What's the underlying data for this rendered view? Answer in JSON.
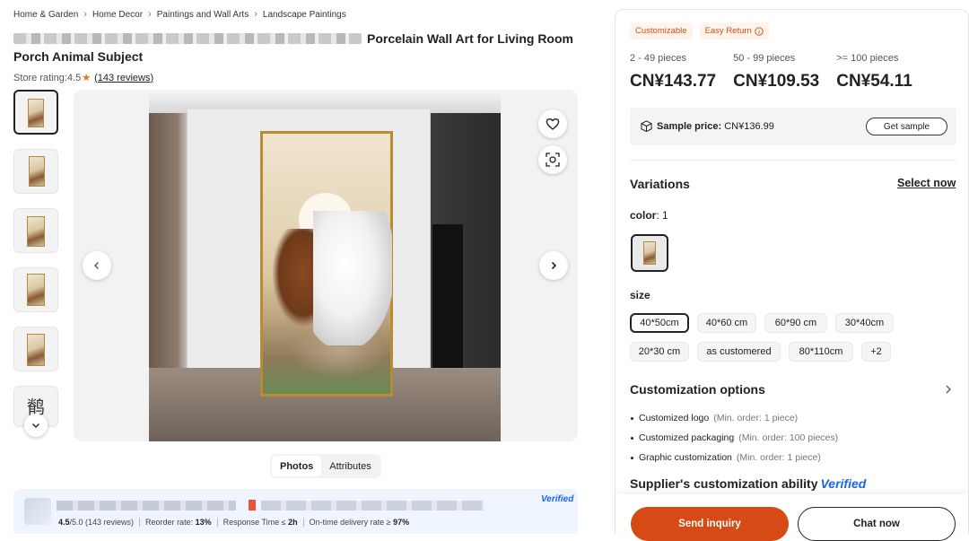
{
  "breadcrumb": [
    "Home & Garden",
    "Home Decor",
    "Paintings and Wall Arts",
    "Landscape Paintings"
  ],
  "product": {
    "title_visible": "Porcelain Wall Art for Living Room Porch Animal Subject",
    "title_line1_tail": "Porcelain Wall Art for Living Room",
    "title_line2": "Porch Animal Subject",
    "store_rating_label": "Store rating:",
    "store_rating_value": "4.5",
    "reviews_link": "(143 reviews)"
  },
  "gallery": {
    "tabs": [
      {
        "label": "Photos",
        "active": true
      },
      {
        "label": "Attributes",
        "active": false
      }
    ],
    "thumbnail_count": 6,
    "selected_thumbnail": 0
  },
  "supplier": {
    "verified": "Verified",
    "rating": "4.5",
    "rating_suffix": "/5.0 (143 reviews)",
    "reorder_label": "Reorder rate:",
    "reorder_value": "13%",
    "response_label": "Response Time ≤",
    "response_value": "2h",
    "ontime_label": "On-time delivery rate ≥",
    "ontime_value": "97%"
  },
  "badges": [
    "Customizable",
    "Easy Return"
  ],
  "pricing": [
    {
      "range": "2 - 49 pieces",
      "price": "CN¥143.77"
    },
    {
      "range": "50 - 99 pieces",
      "price": "CN¥109.53"
    },
    {
      "range": ">= 100 pieces",
      "price": "CN¥54.11"
    }
  ],
  "sample": {
    "label": "Sample price:",
    "price": "CN¥136.99",
    "button": "Get sample"
  },
  "variations": {
    "title": "Variations",
    "select_now": "Select now",
    "color_label": "color",
    "color_count": ": 1",
    "size_label": "size",
    "sizes": [
      "40*50cm",
      "40*60 cm",
      "60*90 cm",
      "30*40cm",
      "20*30 cm",
      "as customered",
      "80*110cm",
      "+2"
    ],
    "selected_size": 0
  },
  "customization": {
    "title": "Customization options",
    "items": [
      {
        "label": "Customized logo",
        "min": "(Min. order: 1 piece)"
      },
      {
        "label": "Customized packaging",
        "min": "(Min. order: 100 pieces)"
      },
      {
        "label": "Graphic customization",
        "min": "(Min. order: 1 piece)"
      }
    ],
    "ability_title": "Supplier's customization ability",
    "ability_badge": "Verified"
  },
  "actions": {
    "inquiry": "Send inquiry",
    "chat": "Chat now"
  },
  "colors": {
    "accent": "#d64a16",
    "badge_text": "#c4531a",
    "verified": "#1668dc",
    "star": "#ff6a00"
  }
}
